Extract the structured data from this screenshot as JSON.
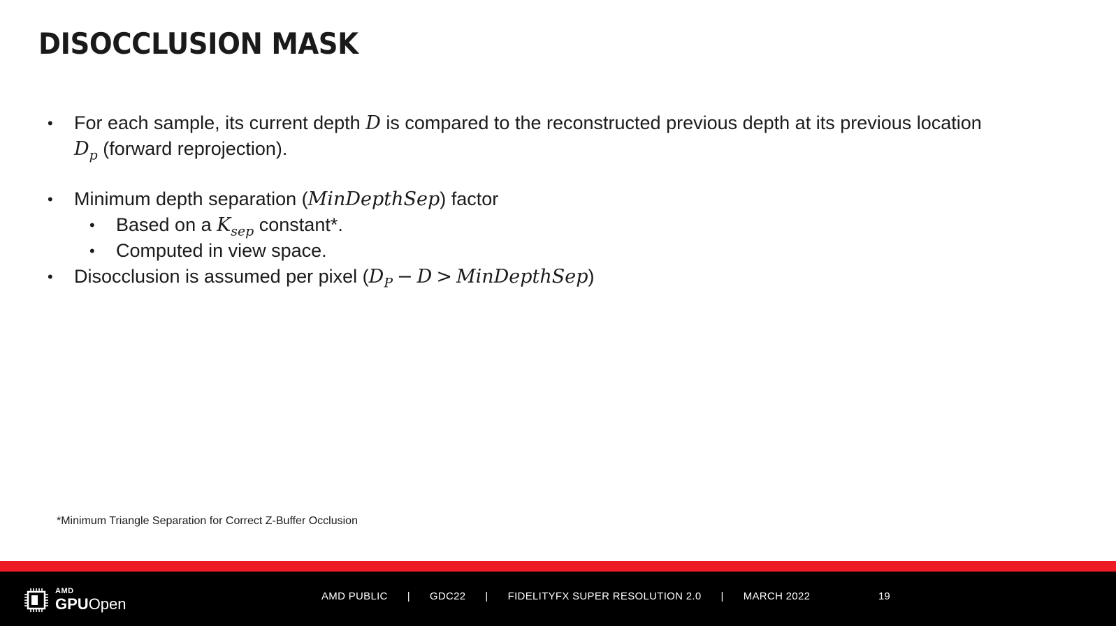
{
  "title": "DISOCCLUSION MASK",
  "bullets": {
    "b1": {
      "text1": "For each sample, its current depth ",
      "math1": "D",
      "text2": " is compared to the reconstructed previous depth at its previous location",
      "math2_base": "D",
      "math2_sub": "p",
      "text3": " (forward reprojection)."
    },
    "b2": {
      "text1": "Minimum depth separation (",
      "math1": "MinDepthSep",
      "text2": ") factor",
      "sub1": {
        "text1": "Based on a ",
        "math_base": "K",
        "math_sub": "sep",
        "text2": " constant*."
      },
      "sub2": {
        "text1": "Computed in view space."
      }
    },
    "b3": {
      "text1": "Disocclusion is assumed per pixel (",
      "math_base1": "D",
      "math_sub1": "P",
      "op1": "−",
      "math2": "D",
      "op2": ">",
      "math3": "MinDepthSep",
      "text2": ")"
    }
  },
  "bullet_glyph": "•",
  "footnote": "*Minimum Triangle Separation for Correct Z-Buffer Occlusion",
  "footer": {
    "logo_amd": "AMD",
    "logo_gpu": "GPU",
    "logo_open": "Open",
    "items": [
      "AMD PUBLIC",
      "GDC22",
      "FIDELITYFX SUPER RESOLUTION 2.0",
      "MARCH 2022"
    ],
    "separator": "|",
    "page_number": "19"
  },
  "colors": {
    "accent_red": "#ed1c24",
    "footer_bg": "#000000",
    "text": "#1b1b1b"
  },
  "icons": {
    "logo": "chip-icon"
  }
}
